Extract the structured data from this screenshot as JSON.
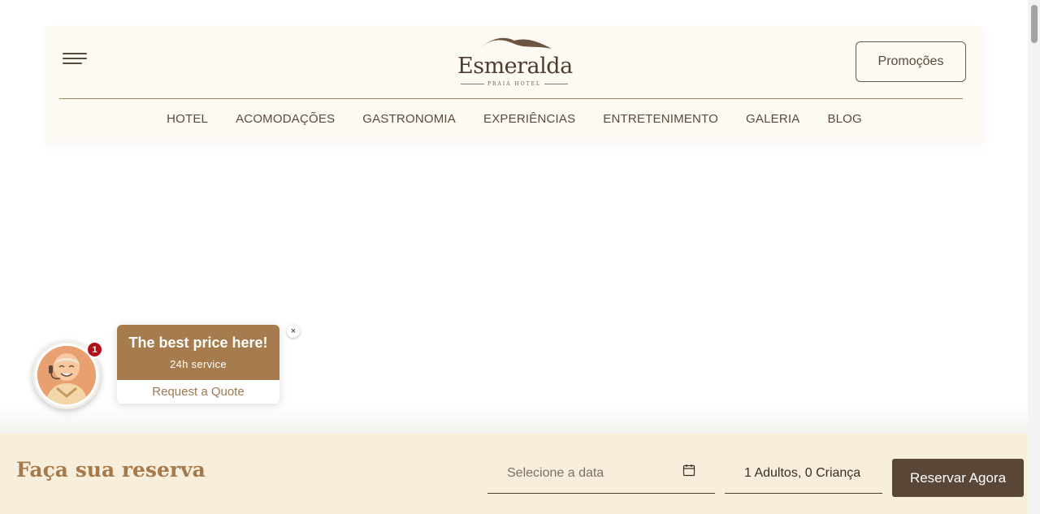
{
  "header": {
    "logo_name": "Esmeralda",
    "logo_sub": "PRAIA HOTEL",
    "promo_label": "Promoções"
  },
  "nav": {
    "items": [
      "HOTEL",
      "ACOMODAÇÕES",
      "GASTRONOMIA",
      "EXPERIÊNCIAS",
      "ENTRETENIMENTO",
      "GALERIA",
      "BLOG"
    ]
  },
  "chat": {
    "badge_count": "1",
    "title": "The best price here!",
    "subtitle": "24h service",
    "quote_label": "Request a Quote",
    "close_symbol": "×"
  },
  "booking": {
    "title": "Faça sua reserva",
    "date_placeholder": "Selecione a data",
    "guests_value": "1 Adultos, 0 Criança",
    "reserve_label": "Reservar Agora"
  },
  "colors": {
    "header_bg": "#fdfaf4",
    "booking_bg": "#f8eedc",
    "brand_brown": "#5a4636",
    "accent_gold": "#a6794a"
  }
}
